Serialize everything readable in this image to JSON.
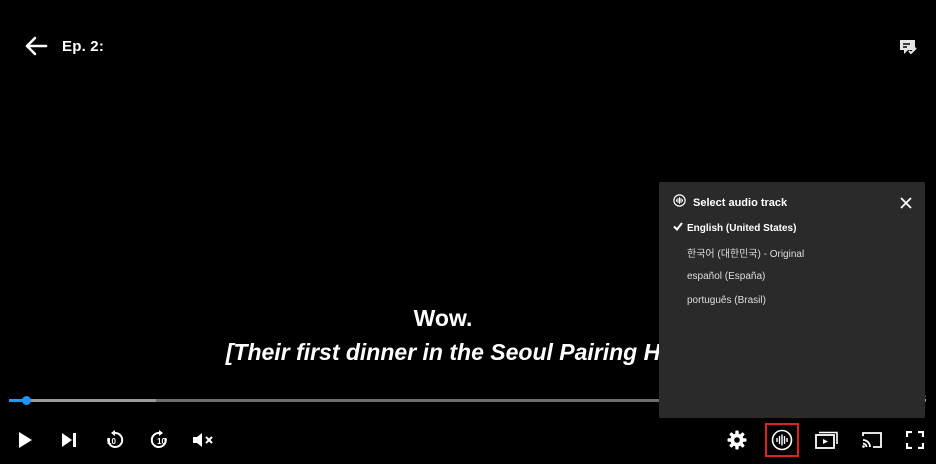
{
  "header": {
    "episode_title": "Ep. 2:"
  },
  "subtitles": {
    "line1": "Wow.",
    "line2": "[Their first dinner in the Seoul Pairing H"
  },
  "progress": {
    "played_fraction": 0.02,
    "buffered_fraction": 0.16,
    "time_end": "8"
  },
  "audio_panel": {
    "title": "Select audio track",
    "options": [
      {
        "label": "English (United States)",
        "selected": true
      },
      {
        "label": "한국어 (대한민국) - Original",
        "selected": false
      },
      {
        "label": "español (España)",
        "selected": false
      },
      {
        "label": "português (Brasil)",
        "selected": false
      }
    ]
  },
  "controls": {
    "rewind_seconds": "10",
    "forward_seconds": "10"
  },
  "colors": {
    "accent": "#2196f3",
    "highlight_box": "#e0201a",
    "panel_bg": "#2a2a2a"
  },
  "icons": [
    "back-arrow-icon",
    "feedback-icon",
    "play-icon",
    "next-episode-icon",
    "rewind-10-icon",
    "forward-10-icon",
    "mute-icon",
    "settings-gear-icon",
    "audio-waveform-icon",
    "episodes-icon",
    "cast-icon",
    "fullscreen-icon",
    "close-icon",
    "checkmark-icon"
  ]
}
